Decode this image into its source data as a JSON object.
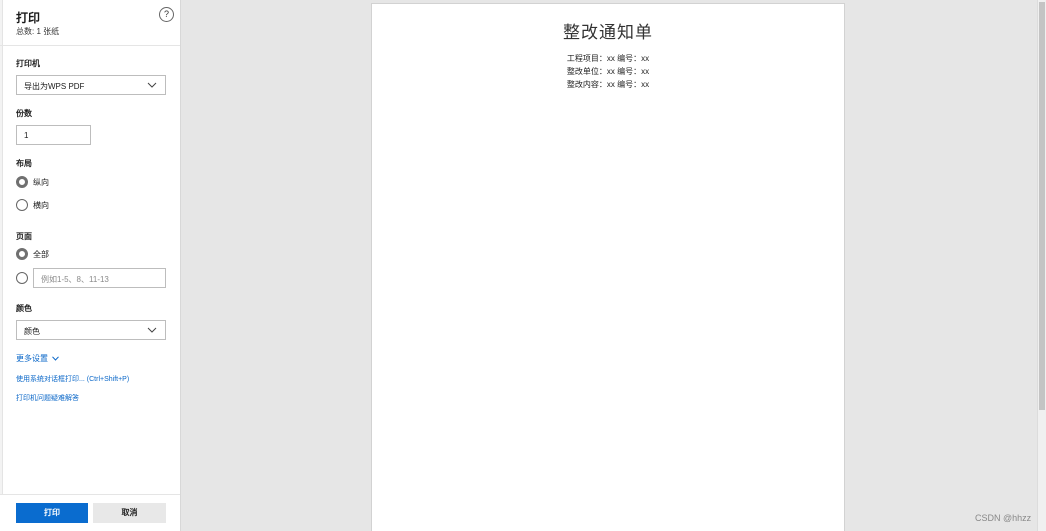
{
  "dialog": {
    "title": "打印",
    "subtitle": "总数: 1 张纸",
    "help_label": "?"
  },
  "printer": {
    "label": "打印机",
    "selected": "导出为WPS PDF"
  },
  "copies": {
    "label": "份数",
    "value": "1"
  },
  "layout": {
    "label": "布局",
    "options": [
      "纵向",
      "横向"
    ],
    "selected": "纵向"
  },
  "pages": {
    "label": "页面",
    "all_label": "全部",
    "range_placeholder": "例如1-5、8、11-13",
    "selected": "全部"
  },
  "color": {
    "label": "颜色",
    "selected": "颜色"
  },
  "links": {
    "more_settings": "更多设置",
    "system_dialog": "使用系统对话框打印... (Ctrl+Shift+P)",
    "troubleshoot": "打印机问题疑难解答"
  },
  "footer": {
    "print_label": "打印",
    "cancel_label": "取消"
  },
  "preview": {
    "doc_title": "整改通知单",
    "lines": [
      "工程项目：xx  编号：xx",
      "整改单位：xx  编号：xx",
      "整改内容：xx  编号：xx"
    ]
  },
  "watermark": "CSDN @hhzz",
  "colors": {
    "accent": "#0a6ccf",
    "link": "#0a67c8",
    "background": "#e6e6e6"
  }
}
